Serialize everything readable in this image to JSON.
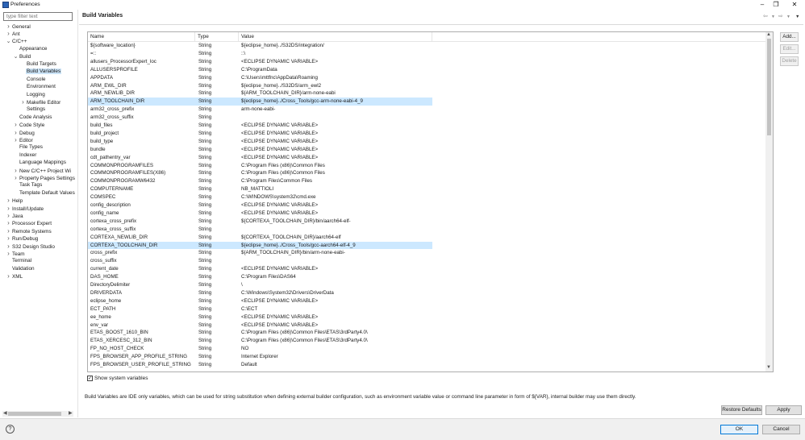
{
  "window": {
    "title": "Preferences"
  },
  "nav": {
    "filter_placeholder": "type filter text",
    "items": [
      {
        "label": "General",
        "level": 0,
        "twisty": "closed"
      },
      {
        "label": "Ant",
        "level": 0,
        "twisty": "closed"
      },
      {
        "label": "C/C++",
        "level": 0,
        "twisty": "open"
      },
      {
        "label": "Appearance",
        "level": 1,
        "twisty": "none"
      },
      {
        "label": "Build",
        "level": 1,
        "twisty": "open"
      },
      {
        "label": "Build Targets",
        "level": 2,
        "twisty": "none"
      },
      {
        "label": "Build Variables",
        "level": 2,
        "twisty": "none",
        "selected": true
      },
      {
        "label": "Console",
        "level": 2,
        "twisty": "none"
      },
      {
        "label": "Environment",
        "level": 2,
        "twisty": "none"
      },
      {
        "label": "Logging",
        "level": 2,
        "twisty": "none"
      },
      {
        "label": "Makefile Editor",
        "level": 2,
        "twisty": "closed"
      },
      {
        "label": "Settings",
        "level": 2,
        "twisty": "none"
      },
      {
        "label": "Code Analysis",
        "level": 1,
        "twisty": "none"
      },
      {
        "label": "Code Style",
        "level": 1,
        "twisty": "closed"
      },
      {
        "label": "Debug",
        "level": 1,
        "twisty": "closed"
      },
      {
        "label": "Editor",
        "level": 1,
        "twisty": "closed"
      },
      {
        "label": "File Types",
        "level": 1,
        "twisty": "none"
      },
      {
        "label": "Indexer",
        "level": 1,
        "twisty": "none"
      },
      {
        "label": "Language Mappings",
        "level": 1,
        "twisty": "none"
      },
      {
        "label": "New C/C++ Project Wi",
        "level": 1,
        "twisty": "closed"
      },
      {
        "label": "Property Pages Settings",
        "level": 1,
        "twisty": "closed"
      },
      {
        "label": "Task Tags",
        "level": 1,
        "twisty": "none"
      },
      {
        "label": "Template Default Values",
        "level": 1,
        "twisty": "none"
      },
      {
        "label": "Help",
        "level": 0,
        "twisty": "closed"
      },
      {
        "label": "Install/Update",
        "level": 0,
        "twisty": "closed"
      },
      {
        "label": "Java",
        "level": 0,
        "twisty": "closed"
      },
      {
        "label": "Processor Expert",
        "level": 0,
        "twisty": "closed"
      },
      {
        "label": "Remote Systems",
        "level": 0,
        "twisty": "closed"
      },
      {
        "label": "Run/Debug",
        "level": 0,
        "twisty": "closed"
      },
      {
        "label": "S32 Design Studio",
        "level": 0,
        "twisty": "closed"
      },
      {
        "label": "Team",
        "level": 0,
        "twisty": "closed"
      },
      {
        "label": "Terminal",
        "level": 0,
        "twisty": "none"
      },
      {
        "label": "Validation",
        "level": 0,
        "twisty": "none"
      },
      {
        "label": "XML",
        "level": 0,
        "twisty": "closed"
      }
    ]
  },
  "panel": {
    "title": "Build Variables",
    "columns": [
      "Name",
      "Type",
      "Value"
    ],
    "rows": [
      {
        "name": "${software_location}",
        "type": "String",
        "value": "${eclipse_home}../S32DS/integration/"
      },
      {
        "name": "=::",
        "type": "String",
        "value": "::\\"
      },
      {
        "name": "allusers_ProcessorExpert_loc",
        "type": "String",
        "value": "<ECLIPSE DYNAMIC VARIABLE>"
      },
      {
        "name": "ALLUSERSPROFILE",
        "type": "String",
        "value": "C:\\ProgramData"
      },
      {
        "name": "APPDATA",
        "type": "String",
        "value": "C:\\Users\\mttfnc\\AppData\\Roaming"
      },
      {
        "name": "ARM_EWL_DIR",
        "type": "String",
        "value": "${eclipse_home}../S32DS/arm_ewl2"
      },
      {
        "name": "ARM_NEWLIB_DIR",
        "type": "String",
        "value": "${ARM_TOOLCHAIN_DIR}/arm-none-eabi"
      },
      {
        "name": "ARM_TOOLCHAIN_DIR",
        "type": "String",
        "value": "${eclipse_home}../Cross_Tools/gcc-arm-none-eabi-4_9",
        "selected": true
      },
      {
        "name": "arm32_cross_prefix",
        "type": "String",
        "value": "arm-none-eabi-"
      },
      {
        "name": "arm32_cross_suffix",
        "type": "String",
        "value": ""
      },
      {
        "name": "build_files",
        "type": "String",
        "value": "<ECLIPSE DYNAMIC VARIABLE>"
      },
      {
        "name": "build_project",
        "type": "String",
        "value": "<ECLIPSE DYNAMIC VARIABLE>"
      },
      {
        "name": "build_type",
        "type": "String",
        "value": "<ECLIPSE DYNAMIC VARIABLE>"
      },
      {
        "name": "bundle",
        "type": "String",
        "value": "<ECLIPSE DYNAMIC VARIABLE>"
      },
      {
        "name": "cdt_pathentry_var",
        "type": "String",
        "value": "<ECLIPSE DYNAMIC VARIABLE>"
      },
      {
        "name": "COMMONPROGRAMFILES",
        "type": "String",
        "value": "C:\\Program Files (x86)\\Common Files"
      },
      {
        "name": "COMMONPROGRAMFILES(X86)",
        "type": "String",
        "value": "C:\\Program Files (x86)\\Common Files"
      },
      {
        "name": "COMMONPROGRAMW6432",
        "type": "String",
        "value": "C:\\Program Files\\Common Files"
      },
      {
        "name": "COMPUTERNAME",
        "type": "String",
        "value": "NB_MATTIOLI"
      },
      {
        "name": "COMSPEC",
        "type": "String",
        "value": "C:\\WINDOWS\\system32\\cmd.exe"
      },
      {
        "name": "config_description",
        "type": "String",
        "value": "<ECLIPSE DYNAMIC VARIABLE>"
      },
      {
        "name": "config_name",
        "type": "String",
        "value": "<ECLIPSE DYNAMIC VARIABLE>"
      },
      {
        "name": "cortexa_cross_prefix",
        "type": "String",
        "value": "${CORTEXA_TOOLCHAIN_DIR}/bin/aarch64-elf-"
      },
      {
        "name": "cortexa_cross_suffix",
        "type": "String",
        "value": ""
      },
      {
        "name": "CORTEXA_NEWLIB_DIR",
        "type": "String",
        "value": "${CORTEXA_TOOLCHAIN_DIR}/aarch64-elf"
      },
      {
        "name": "CORTEXA_TOOLCHAIN_DIR",
        "type": "String",
        "value": "${eclipse_home}../Cross_Tools/gcc-aarch64-elf-4_9",
        "selected": true
      },
      {
        "name": "cross_prefix",
        "type": "String",
        "value": "${ARM_TOOLCHAIN_DIR}/bin/arm-none-eabi-"
      },
      {
        "name": "cross_suffix",
        "type": "String",
        "value": ""
      },
      {
        "name": "current_date",
        "type": "String",
        "value": "<ECLIPSE DYNAMIC VARIABLE>"
      },
      {
        "name": "DAS_HOME",
        "type": "String",
        "value": "C:\\Program Files\\DAS64"
      },
      {
        "name": "DirectoryDelimiter",
        "type": "String",
        "value": "\\"
      },
      {
        "name": "DRIVERDATA",
        "type": "String",
        "value": "C:\\Windows\\System32\\Drivers\\DriverData"
      },
      {
        "name": "eclipse_home",
        "type": "String",
        "value": "<ECLIPSE DYNAMIC VARIABLE>"
      },
      {
        "name": "ECT_PATH",
        "type": "String",
        "value": "C:\\ECT"
      },
      {
        "name": "ee_home",
        "type": "String",
        "value": "<ECLIPSE DYNAMIC VARIABLE>"
      },
      {
        "name": "env_var",
        "type": "String",
        "value": "<ECLIPSE DYNAMIC VARIABLE>"
      },
      {
        "name": "ETAS_BOOST_1610_BIN",
        "type": "String",
        "value": "C:\\Program Files (x86)\\Common Files\\ETAS\\3rdParty4.0\\"
      },
      {
        "name": "ETAS_XERCESC_312_BIN",
        "type": "String",
        "value": "C:\\Program Files (x86)\\Common Files\\ETAS\\3rdParty4.0\\"
      },
      {
        "name": "FP_NO_HOST_CHECK",
        "type": "String",
        "value": "NO"
      },
      {
        "name": "FPS_BROWSER_APP_PROFILE_STRING",
        "type": "String",
        "value": "Internet Explorer"
      },
      {
        "name": "FPS_BROWSER_USER_PROFILE_STRING",
        "type": "String",
        "value": "Default"
      }
    ],
    "buttons": {
      "add": "Add...",
      "edit": "Edit...",
      "delete": "Delete"
    },
    "show_system_label": "Show system variables",
    "show_system_checked": true,
    "description": "Build Variables are IDE only variables, which can be used for string substitution when defining external builder configuration, such as environment variable value or command line parameter in form of ${VAR}, internal builder may use them directly.",
    "restore_defaults": "Restore Defaults",
    "apply": "Apply"
  },
  "footer": {
    "ok": "OK",
    "cancel": "Cancel"
  },
  "colors": {
    "selection": "#cce8ff",
    "accent": "#0078d7"
  },
  "icons": {
    "app": "preferences-icon",
    "help": "help-icon",
    "back": "back-arrow-icon",
    "forward": "forward-arrow-icon",
    "menu": "view-menu-icon"
  }
}
